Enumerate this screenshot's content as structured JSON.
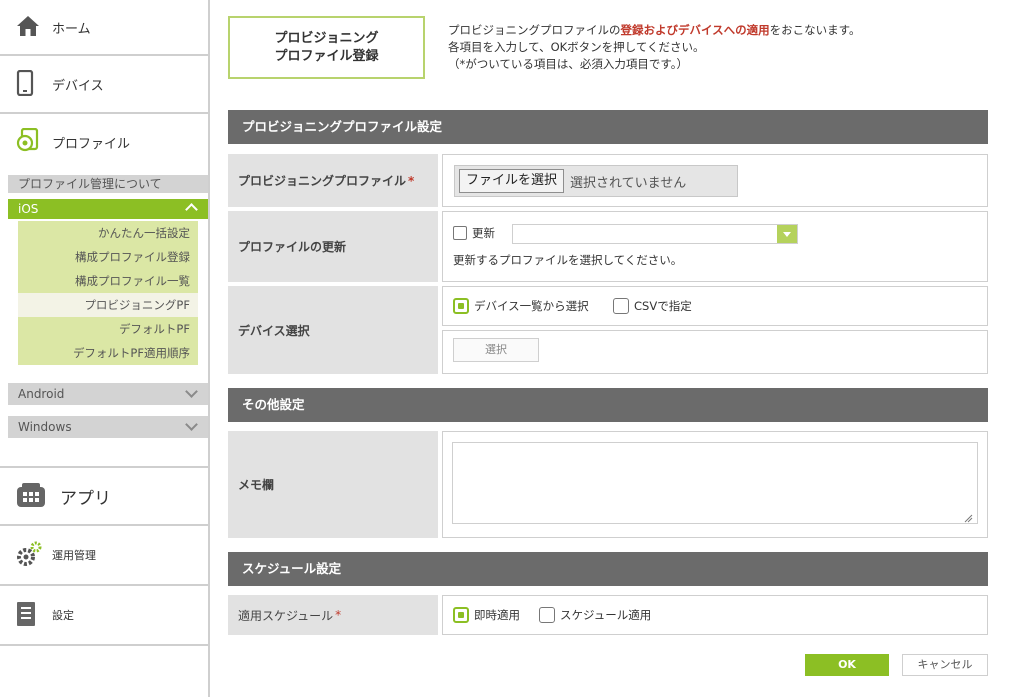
{
  "sidebar": {
    "home_label": "ホーム",
    "device_label": "デバイス",
    "profile_label": "プロファイル",
    "profile_about": "プロファイル管理について",
    "ios_label": "iOS",
    "ios_items": [
      "かんたん一括設定",
      "構成プロファイル登録",
      "構成プロファイル一覧",
      "プロビジョニングPF",
      "デフォルトPF",
      "デフォルトPF適用順序"
    ],
    "android_label": "Android",
    "windows_label": "Windows",
    "app_label": "アプリ",
    "ops_label": "運用管理",
    "settings_label": "設定"
  },
  "header": {
    "title": "プロビジョニング\nプロファイル登録",
    "intro_line1_pre": "プロビジョニングプロファイルの",
    "intro_line1_red": "登録およびデバイスへの適用",
    "intro_line1_post": "をおこないます。",
    "intro_line2": "各項目を入力して、OKボタンを押してください。",
    "intro_line3": "（*がついている項目は、必須入力項目です。）"
  },
  "sections": {
    "provisioning": "プロビジョニングプロファイル設定",
    "other": "その他設定",
    "schedule": "スケジュール設定"
  },
  "form": {
    "pp_label": "プロビジョニングプロファイル",
    "required_mark": "*",
    "file_button": "ファイルを選択",
    "file_status": "選択されていません",
    "update_label": "プロファイルの更新",
    "update_checkbox": "更新",
    "update_hint": "更新するプロファイルを選択してください。",
    "device_label": "デバイス選択",
    "device_opt_list": "デバイス一覧から選択",
    "device_opt_csv": "CSVで指定",
    "select_button": "選択",
    "memo_label": "メモ欄",
    "schedule_label": "適用スケジュール",
    "schedule_opt_now": "即時適用",
    "schedule_opt_sched": "スケジュール適用"
  },
  "actions": {
    "ok": "OK",
    "cancel": "キャンセル"
  },
  "colors": {
    "accent_green": "#8cbf24",
    "required_red": "#c0392b",
    "section_gray": "#6b6b6b"
  }
}
